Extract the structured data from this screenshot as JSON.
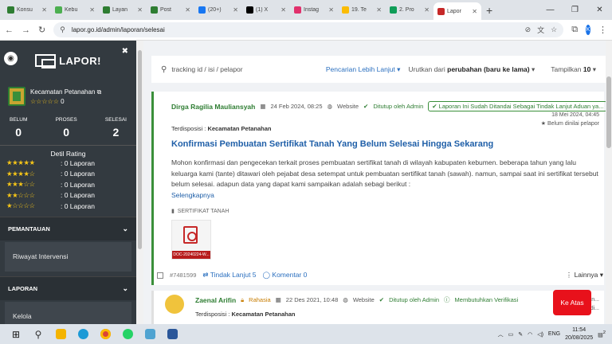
{
  "browser": {
    "tabs": [
      {
        "label": "Konsu",
        "color": "#2e7d32"
      },
      {
        "label": "Kebu",
        "color": "#4caf50"
      },
      {
        "label": "Layan",
        "color": "#2e7d32"
      },
      {
        "label": "Post",
        "color": "#2e7d32"
      },
      {
        "label": "(20+)",
        "color": "#1877f2"
      },
      {
        "label": "(1) X",
        "color": "#000000"
      },
      {
        "label": "Instag",
        "color": "#e1306c"
      },
      {
        "label": "19. Te",
        "color": "#fbbc04"
      },
      {
        "label": "2. Pro",
        "color": "#0f9d58"
      },
      {
        "label": "Lapor",
        "color": "#c62828",
        "active": true
      }
    ],
    "url": "lapor.go.id/admin/laporan/selesai"
  },
  "sidebar": {
    "logo": "LAPOR!",
    "agency_name": "Kecamatan Petanahan",
    "agency_rating": "0",
    "stats": [
      {
        "label": "BELUM",
        "value": "0"
      },
      {
        "label": "PROSES",
        "value": "0"
      },
      {
        "label": "SELESAI",
        "value": "2"
      }
    ],
    "rating_title": "Detil Rating",
    "ratings": [
      {
        "stars": "★★★★★",
        "text": ": 0 Laporan"
      },
      {
        "stars": "★★★★☆",
        "text": ": 0 Laporan"
      },
      {
        "stars": "★★★☆☆",
        "text": ": 0 Laporan"
      },
      {
        "stars": "★★☆☆☆",
        "text": ": 0 Laporan"
      },
      {
        "stars": "★☆☆☆☆",
        "text": ": 0 Laporan"
      }
    ],
    "section_monitoring": "PEMANTAUAN",
    "item_intervensi": "Riwayat Intervensi",
    "section_laporan": "LAPORAN",
    "item_kelola": "Kelola"
  },
  "search": {
    "placeholder": "tracking id / isi / pelapor",
    "advanced": "Pencarian Lebih Lanjut",
    "sort_prefix": "Urutkan dari",
    "sort_value": "perubahan (baru ke lama)",
    "show_prefix": "Tampilkan",
    "show_value": "10"
  },
  "report1": {
    "name": "Dirga Ragilia Mauliansyah",
    "date": "24 Feb 2024, 08:25",
    "channel": "Website",
    "status": "Ditutup oleh Admin",
    "flag": "Laporan Ini Sudah Ditandai Sebagai Tindak Lanjut Aduan ya...",
    "right_date": "18 Mei 2024, 04:45",
    "right_rating": "Belum dinilai pelapor",
    "disp_label": "Terdisposisi :",
    "disp_value": "Kecamatan Petanahan",
    "title": "Konfirmasi Pembuatan Sertifikat Tanah Yang Belum Selesai Hingga Sekarang",
    "body": "Mohon konfirmasi dan pengecekan terkait proses pembuatan sertifikat tanah di wilayah kabupaten kebumen. beberapa tahun yang lalu keluarga kami (tante) ditawari oleh pejabat desa setempat untuk pembuatan sertifikat tanah (sawah). namun, sampai saat ini sertifikat tersebut belum selesai. adapun data yang dapat kami sampaikan adalah sebagi berikut :",
    "more": "Selengkapnya",
    "tag": "SERTIFIKAT TANAH",
    "attachment": "DOC-20240224-W...",
    "id": "#7481599",
    "followup": "Tindak Lanjut 5",
    "comments": "Komentar 0",
    "other": "Lainnya"
  },
  "report2": {
    "name": "Zaenal Arifin",
    "secret": "Rahasia",
    "date": "22 Des 2021, 10:48",
    "channel": "Website",
    "status": "Ditutup oleh Admin",
    "verify": "Membutuhkan Verifikasi",
    "right_date": "29 Jan...",
    "right_rating": "Belum di...",
    "disp_label": "Terdisposisi :",
    "disp_value": "Kecamatan Petanahan"
  },
  "float_button": "Ke Atas",
  "taskbar": {
    "lang": "ENG",
    "time": "11:54",
    "date": "20/08/2025",
    "notif": "2"
  }
}
